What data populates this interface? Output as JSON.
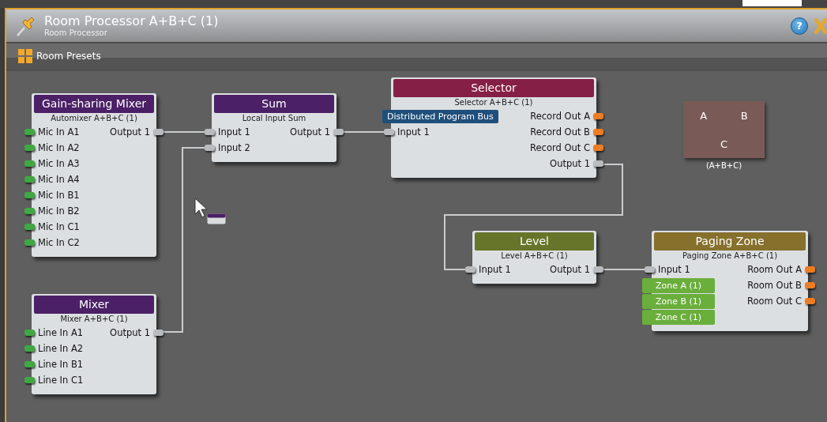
{
  "window": {
    "title": "Room Processor A+B+C (1)",
    "subtitle": "Room Processor",
    "help_button": "?"
  },
  "toolbar": {
    "presets_button": "Room Presets"
  },
  "blocks": [
    {
      "title": "Gain-sharing Mixer",
      "subtitle": "Automixer A+B+C (1)",
      "color": "#4b2066",
      "inputs": [
        {
          "label": "Mic In A1",
          "kind": "source"
        },
        {
          "label": "Mic In A2",
          "kind": "source"
        },
        {
          "label": "Mic In A3",
          "kind": "source"
        },
        {
          "label": "Mic In A4",
          "kind": "source"
        },
        {
          "label": "Mic In B1",
          "kind": "source"
        },
        {
          "label": "Mic In B2",
          "kind": "source"
        },
        {
          "label": "Mic In C1",
          "kind": "source"
        },
        {
          "label": "Mic In C2",
          "kind": "source"
        }
      ],
      "outputs": [
        {
          "label": "Output 1",
          "kind": "wire"
        }
      ]
    },
    {
      "title": "Sum",
      "subtitle": "Local Input Sum",
      "color": "#4b2066",
      "inputs": [
        {
          "label": "Input 1",
          "kind": "wire"
        },
        {
          "label": "Input 2",
          "kind": "wire"
        }
      ],
      "outputs": [
        {
          "label": "Output 1",
          "kind": "wire"
        }
      ]
    },
    {
      "title": "Selector",
      "subtitle": "Selector A+B+C (1)",
      "color": "#861f45",
      "inputs": [
        {
          "label": "Distributed Program Bus",
          "kind": "bus"
        },
        {
          "label": "Input 1",
          "kind": "wire"
        }
      ],
      "outputs": [
        {
          "label": "Record Out A",
          "kind": "record"
        },
        {
          "label": "Record Out B",
          "kind": "record"
        },
        {
          "label": "Record Out C",
          "kind": "record"
        },
        {
          "label": "Output 1",
          "kind": "wire"
        }
      ]
    },
    {
      "title": "Level",
      "subtitle": "Level A+B+C (1)",
      "color": "#66752a",
      "inputs": [
        {
          "label": "Input 1",
          "kind": "wire"
        }
      ],
      "outputs": [
        {
          "label": "Output 1",
          "kind": "wire"
        }
      ]
    },
    {
      "title": "Paging Zone",
      "subtitle": "Paging Zone A+B+C (1)",
      "color": "#86702c",
      "inputs": [
        {
          "label": "Input 1",
          "kind": "wire"
        },
        {
          "label": "Zone A (1)",
          "kind": "zone"
        },
        {
          "label": "Zone B (1)",
          "kind": "zone"
        },
        {
          "label": "Zone C (1)",
          "kind": "zone"
        }
      ],
      "outputs": [
        {
          "label": "Room Out A",
          "kind": "record"
        },
        {
          "label": "Room Out B",
          "kind": "record"
        },
        {
          "label": "Room Out C",
          "kind": "record"
        }
      ]
    },
    {
      "title": "Mixer",
      "subtitle": "Mixer A+B+C (1)",
      "color": "#4b2066",
      "inputs": [
        {
          "label": "Line In A1",
          "kind": "source"
        },
        {
          "label": "Line In A2",
          "kind": "source"
        },
        {
          "label": "Line In B1",
          "kind": "source"
        },
        {
          "label": "Line In C1",
          "kind": "source"
        }
      ],
      "outputs": [
        {
          "label": "Output 1",
          "kind": "wire"
        }
      ]
    }
  ],
  "room_map": {
    "cells": [
      "A",
      "B",
      "C"
    ],
    "label": "(A+B+C)"
  }
}
